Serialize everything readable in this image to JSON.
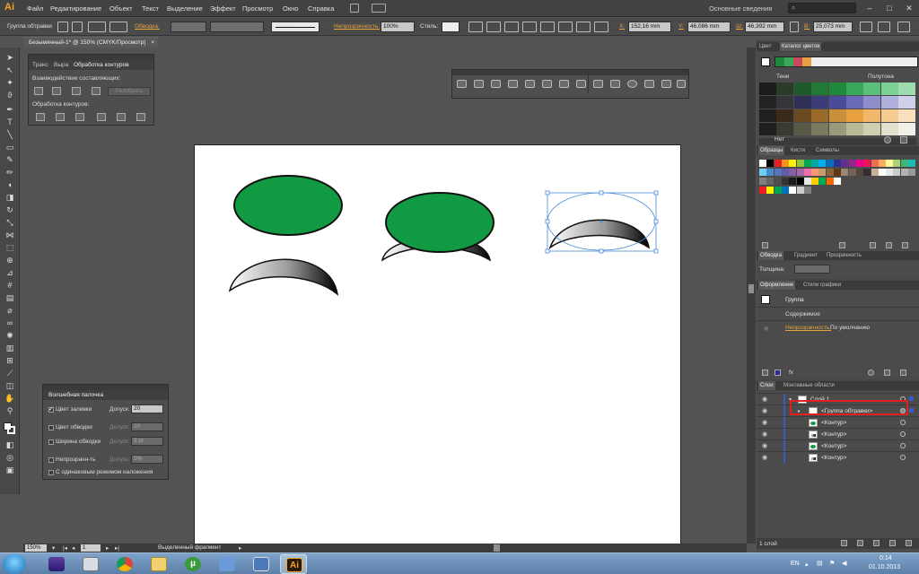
{
  "app": {
    "logo": "Ai"
  },
  "menu": {
    "items": [
      "Файл",
      "Редактирование",
      "Объект",
      "Текст",
      "Выделение",
      "Эффект",
      "Просмотр",
      "Окно",
      "Справка"
    ],
    "workspace": "Основные сведения",
    "window_controls": [
      "–",
      "□",
      "✕"
    ]
  },
  "control": {
    "selection_type": "Группа обтравки",
    "stroke_label": "Обводка:",
    "stroke_style": "Базовая",
    "opacity_label": "Непрозрачность:",
    "opacity_value": "100%",
    "style_label": "Стиль:",
    "x_label": "X:",
    "x_value": "152,16 mm",
    "y_label": "Y:",
    "y_value": "46,086 mm",
    "w_label": "Ш:",
    "w_value": "46,392 mm",
    "h_label": "В:",
    "h_value": "25,073 mm"
  },
  "document": {
    "tab_title": "Безымянный-1* @ 150% (CMYK/Просмотр)",
    "close": "×"
  },
  "pathfinder": {
    "tabs": [
      "Транс",
      "Выра",
      "Обработка контуров"
    ],
    "shape_modes_label": "Взаимодействие составляющих:",
    "expand_button": "Разобрать",
    "pathfinders_label": "Обработка контуров:"
  },
  "magic_wand": {
    "title": "Волшебная палочка",
    "rows": [
      {
        "label": "Цвет заливки",
        "checked": true,
        "tol_label": "Допуск:",
        "value": "20"
      },
      {
        "label": "Цвет обводки",
        "checked": false,
        "tol_label": "Допуск:",
        "value": "20"
      },
      {
        "label": "Ширина обводки",
        "checked": false,
        "tol_label": "Допуск:",
        "value": "5 pt"
      },
      {
        "label": "Непрозрачн-ть",
        "checked": false,
        "tol_label": "Допуск:",
        "value": "5%"
      }
    ],
    "blend_label": "С одинаковым режимом наложения"
  },
  "color_guide": {
    "tabs": [
      "Цвет",
      "Каталог цветов"
    ],
    "shades_label": "Тени",
    "tints_label": "Полутона",
    "none_label": "Нет",
    "harmony_colors": [
      "#1f8a3b",
      "#3aa85a",
      "#c94a5a",
      "#e8a040"
    ],
    "grid_colors": [
      [
        "#1c1c1c",
        "#2a3b2a",
        "#1f5a2c",
        "#207a35",
        "#1f8a3b",
        "#3aa85a",
        "#5ac07a",
        "#7cd096",
        "#a0dcb2"
      ],
      [
        "#222",
        "#35363a",
        "#2e3055",
        "#3c3c78",
        "#4b4b9a",
        "#6a6ab8",
        "#8e8ecc",
        "#b0b0dc",
        "#d0d0ea"
      ],
      [
        "#202020",
        "#3a2a1a",
        "#6a4a20",
        "#9a6a2a",
        "#c8903a",
        "#e8a040",
        "#f0b868",
        "#f4cc92",
        "#f8e0bc"
      ],
      [
        "#1e1e1e",
        "#3a3a30",
        "#5a5a48",
        "#7a7a60",
        "#9a9a7a",
        "#baba96",
        "#cfcfb2",
        "#e0e0cc",
        "#f0f0e6"
      ]
    ]
  },
  "swatches": {
    "tabs": [
      "Образцы",
      "Кисти",
      "Символы"
    ],
    "row1": [
      "#ffffff",
      "#000000",
      "#ed1c24",
      "#f7941d",
      "#fff200",
      "#8dc63f",
      "#00a651",
      "#00a99d",
      "#00aeef",
      "#0072bc",
      "#2e3192",
      "#662d91",
      "#92278f",
      "#ec008c",
      "#ed145b",
      "#f26c4f",
      "#fbaf5d",
      "#fff799",
      "#acd373",
      "#3cb878",
      "#1cbbb4"
    ],
    "row2": [
      "#6dcff6",
      "#448ccb",
      "#5674b9",
      "#605ca8",
      "#8560a8",
      "#a864a8",
      "#f06eaa",
      "#f69679",
      "#c69c6d",
      "#8c6239",
      "#603913",
      "#998675",
      "#736357",
      "#534741",
      "#362f2d",
      "#c7b299",
      "#ffffff",
      "#e6e6e6",
      "#cccccc",
      "#b3b3b3",
      "#999999"
    ],
    "row3": [
      "#808080",
      "#666666",
      "#4d4d4d",
      "#333333",
      "#1a1a1a",
      "#000000",
      "#e6e6e6",
      "#ffcc00",
      "#00aa55",
      "#ff6600",
      "#ffffff"
    ],
    "row4": [
      "#ed1c24",
      "#fff200",
      "#00a651",
      "#0072bc",
      "#ffffff",
      "#cccccc",
      "#808080"
    ]
  },
  "stroke_panel": {
    "tabs": [
      "Обводка",
      "Градиент",
      "Прозрачность"
    ],
    "weight_label": "Толщина:"
  },
  "appearance": {
    "tabs": [
      "Оформление",
      "Стили графики"
    ],
    "object": "Группа",
    "contents": "Содержимое",
    "opacity_label": "Непрозрачность:",
    "opacity_value": "По умолчанию",
    "fx": "fx"
  },
  "layers": {
    "tabs": [
      "Слои",
      "Монтажные области"
    ],
    "rows": [
      {
        "name": "Слой 1",
        "thumb": "#ffffff"
      },
      {
        "name": "<Группа обтравки>",
        "thumb": "#ffffff"
      },
      {
        "name": "<Контур>",
        "thumb": "#1f8a3b"
      },
      {
        "name": "<Контур>",
        "thumb": "#888888"
      },
      {
        "name": "<Контур>",
        "thumb": "#1f8a3b"
      },
      {
        "name": "<Контур>",
        "thumb": "#888888"
      }
    ],
    "footer": "1 слой",
    "highlight_color": "#e02020"
  },
  "status": {
    "zoom": "150%",
    "artboard": "1",
    "tool_info": "Выделенный фрагмент"
  },
  "taskbar": {
    "apps": [
      "media",
      "calc",
      "chrome",
      "folder",
      "utorrent",
      "notes",
      "picture",
      "illustrator"
    ],
    "illustrator_label": "Ai",
    "language": "EN",
    "time": "0:14",
    "date": "01.10.2013"
  },
  "colors": {
    "green": "#119a42",
    "selection_blue": "#4a8cd8",
    "accent_orange": "#e8a33d"
  }
}
